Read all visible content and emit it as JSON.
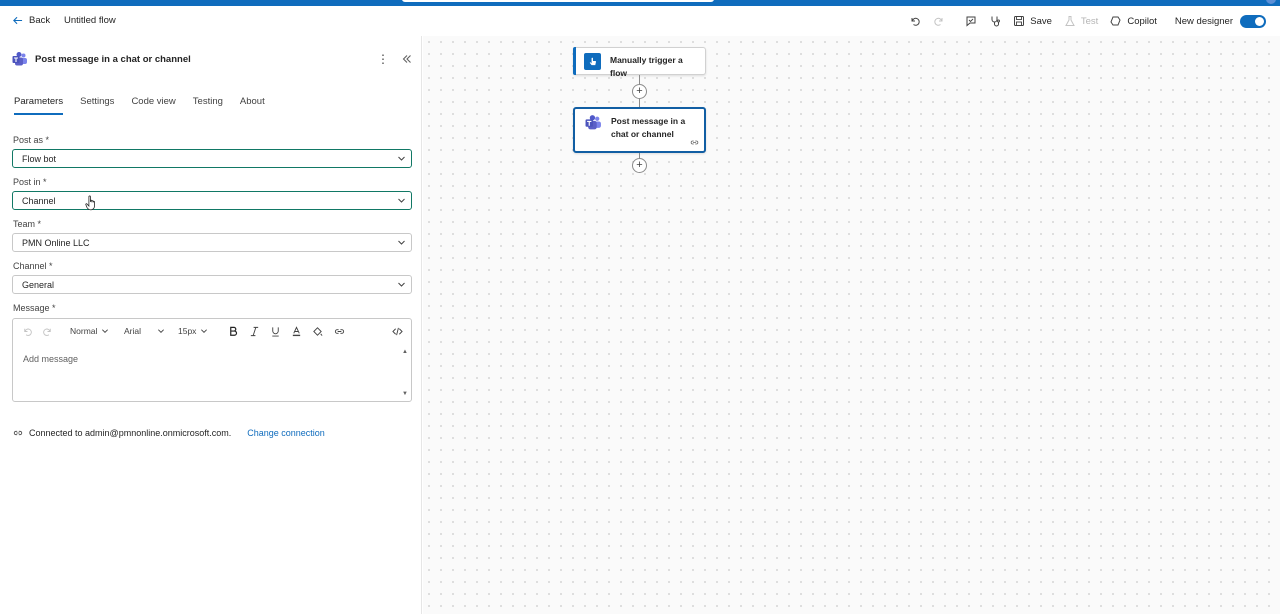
{
  "header": {
    "back_label": "Back",
    "flow_name": "Untitled flow",
    "save_label": "Save",
    "test_label": "Test",
    "copilot_label": "Copilot",
    "new_designer_label": "New designer",
    "new_designer_on": true
  },
  "panel": {
    "title": "Post message in a chat or channel",
    "tabs": [
      {
        "label": "Parameters",
        "active": true
      },
      {
        "label": "Settings"
      },
      {
        "label": "Code view"
      },
      {
        "label": "Testing"
      },
      {
        "label": "About"
      }
    ],
    "fields": {
      "post_as": {
        "label": "Post as *",
        "value": "Flow bot"
      },
      "post_in": {
        "label": "Post in *",
        "value": "Channel"
      },
      "team": {
        "label": "Team *",
        "value": "PMN Online LLC"
      },
      "channel": {
        "label": "Channel *",
        "value": "General"
      },
      "message": {
        "label": "Message *",
        "placeholder": "Add message"
      }
    },
    "editor_toolbar": {
      "style": "Normal",
      "font": "Arial",
      "size": "15px"
    },
    "connection": {
      "text": "Connected to admin@pmnonline.onmicrosoft.com.",
      "change_label": "Change connection"
    }
  },
  "canvas": {
    "nodes": [
      {
        "title": "Manually trigger a flow",
        "icon": "manual-trigger-icon"
      },
      {
        "title": "Post message in a chat or channel",
        "icon": "teams-icon",
        "selected": true
      }
    ]
  },
  "colors": {
    "accent": "#0f6cbd",
    "focus_border": "#117865",
    "teams_purple": "#5b5fc7"
  }
}
